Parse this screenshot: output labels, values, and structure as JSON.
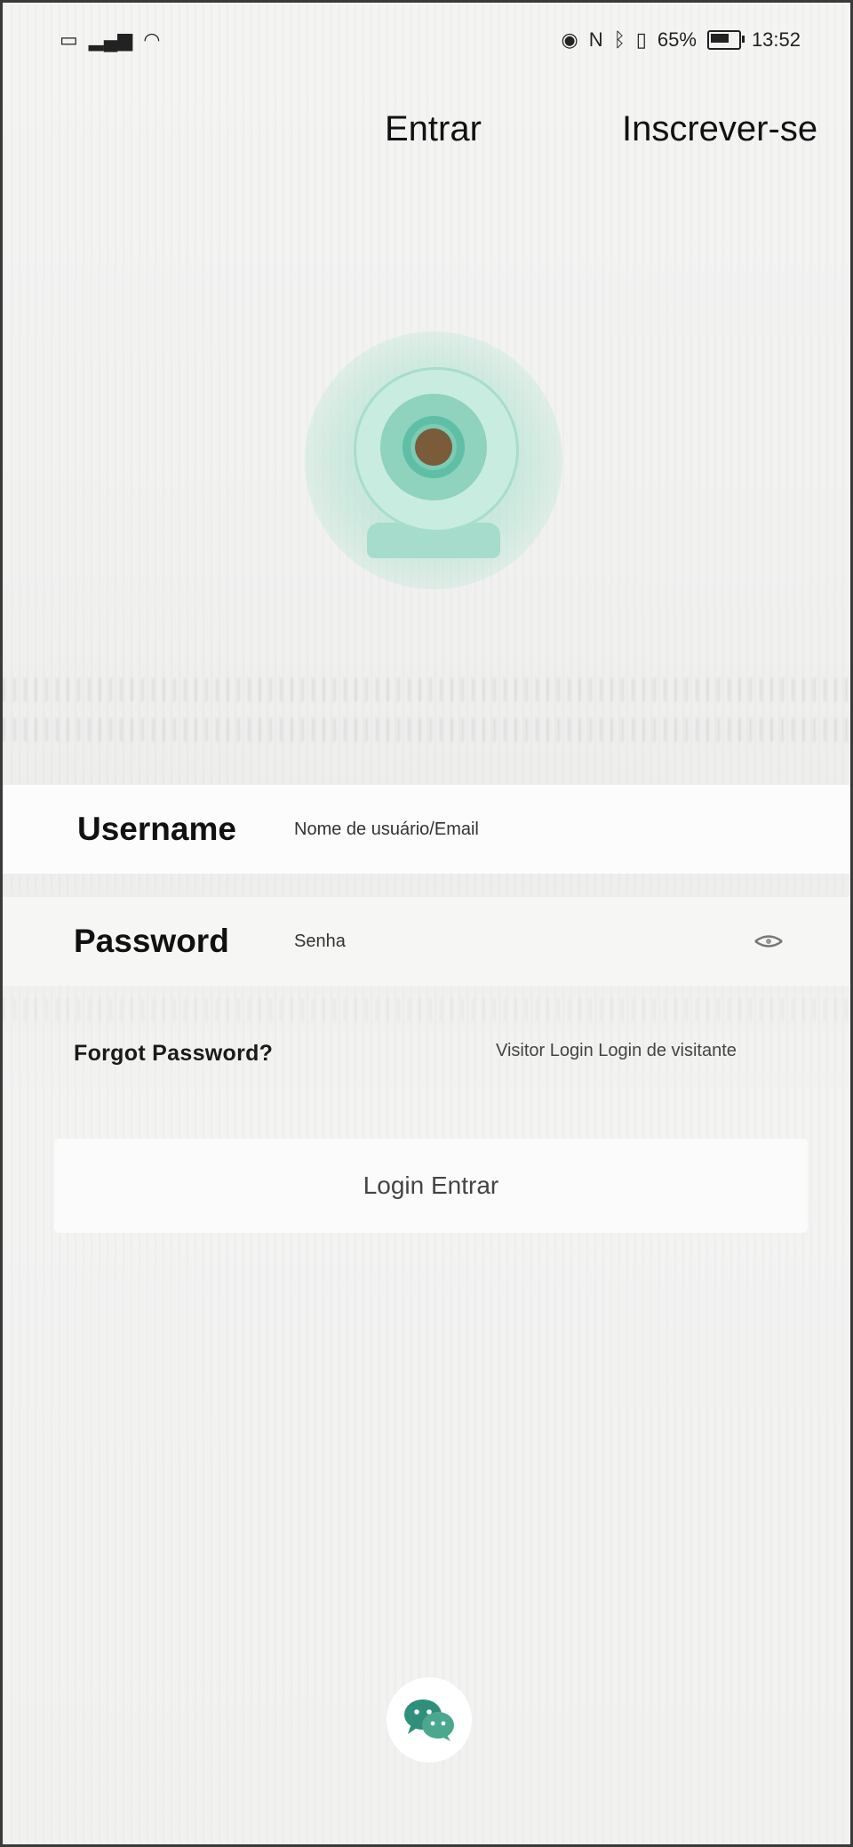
{
  "status_bar": {
    "time": "13:52",
    "battery_percent": "65%",
    "left_icons": [
      "sim-icon",
      "signal-icon",
      "wifi-icon"
    ],
    "right_icons": [
      "eye-icon",
      "nfc-icon",
      "bluetooth-icon",
      "vibrate-icon"
    ]
  },
  "tabs": {
    "login_label": "Entrar",
    "register_label": "Inscrever-se"
  },
  "form": {
    "username_label": "Username",
    "username_placeholder": "Nome de usuário/Email",
    "password_label": "Password",
    "password_placeholder": "Senha",
    "forgot_label": "Forgot Password?",
    "visitor_label": "Visitor Login Login de visitante",
    "login_button_label": "Login Entrar"
  },
  "colors": {
    "accent": "#7ccbb5",
    "social_icon": "#2f8f7a"
  },
  "social": {
    "icon": "wechat-icon"
  }
}
